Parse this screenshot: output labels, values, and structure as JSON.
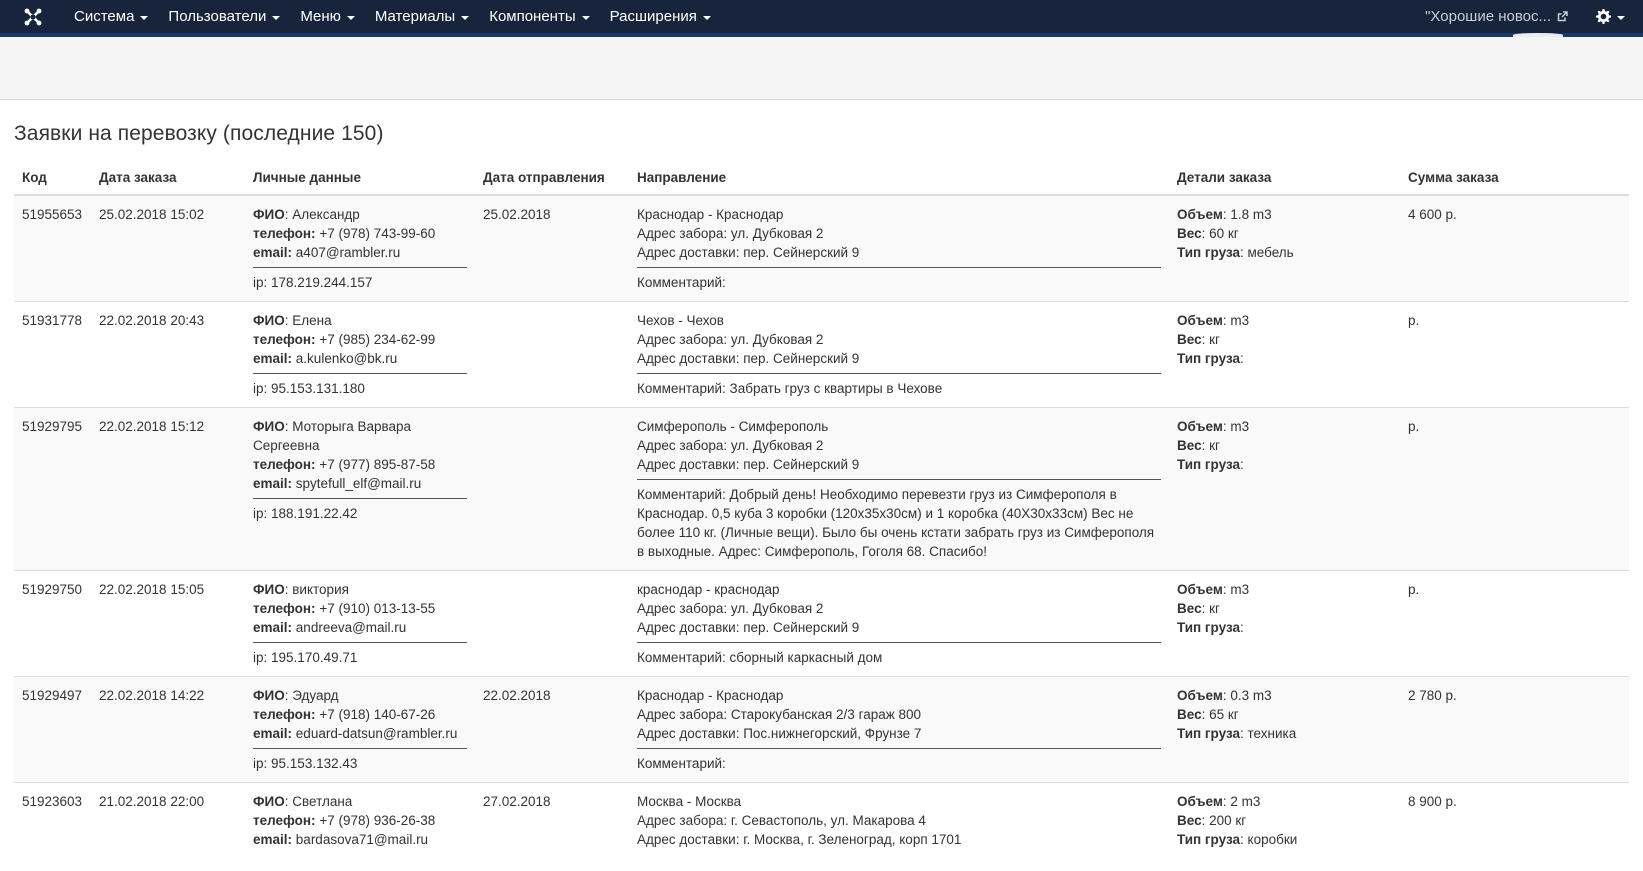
{
  "navbar": {
    "menu": [
      {
        "label": "Система"
      },
      {
        "label": "Пользователи"
      },
      {
        "label": "Меню"
      },
      {
        "label": "Материалы"
      },
      {
        "label": "Компоненты"
      },
      {
        "label": "Расширения"
      }
    ],
    "site_link": "\"Хорошие новос...",
    "colors": {
      "navbar_bg": "#17243c",
      "navbar_border": "#1a3867"
    }
  },
  "page": {
    "title": "Заявки на перевозку (последние 150)"
  },
  "labels": {
    "fio": "ФИО",
    "phone": "телефон:",
    "email": "email:",
    "ip": "ip:",
    "pickup": "Адрес забора:",
    "delivery": "Адрес доставки:",
    "comment": "Комментарий:",
    "volume": "Объем",
    "weight": "Вес",
    "cargo_type": "Тип груза"
  },
  "table": {
    "headers": {
      "code": "Код",
      "order_date": "Дата заказа",
      "personal": "Личные данные",
      "send_date": "Дата отправления",
      "direction": "Направление",
      "details": "Детали заказа",
      "sum": "Сумма заказа"
    },
    "rows": [
      {
        "code": "51955653",
        "order_date": "25.02.2018 15:02",
        "name": "Александр",
        "phone": "+7 (978) 743-99-60",
        "email": "a407@rambler.ru",
        "ip": "178.219.244.157",
        "send_date": "25.02.2018",
        "route": "Краснодар - Краснодар",
        "pickup": "ул. Дубковая 2",
        "delivery": "пер. Сейнерский 9",
        "comment": "",
        "volume": "1.8 m3",
        "weight": "60 кг",
        "cargo": "мебель",
        "sum": "4 600 р."
      },
      {
        "code": "51931778",
        "order_date": "22.02.2018 20:43",
        "name": "Елена",
        "phone": "+7 (985) 234-62-99",
        "email": "a.kulenko@bk.ru",
        "ip": "95.153.131.180",
        "send_date": "",
        "route": "Чехов - Чехов",
        "pickup": "ул. Дубковая 2",
        "delivery": "пер. Сейнерский 9",
        "comment": "Забрать груз с квартиры в Чехове",
        "volume": "m3",
        "weight": "кг",
        "cargo": "",
        "sum": "р."
      },
      {
        "code": "51929795",
        "order_date": "22.02.2018 15:12",
        "name": "Моторыга Варвара Сергеевна",
        "phone": "+7 (977) 895-87-58",
        "email": "spytefull_elf@mail.ru",
        "ip": "188.191.22.42",
        "send_date": "",
        "route": "Симферополь - Симферополь",
        "pickup": "ул. Дубковая 2",
        "delivery": "пер. Сейнерский 9",
        "comment": "Добрый день! Необходимо перевезти груз из Симферополя в Краснодар. 0,5 куба 3 коробки (120х35х30см) и 1 коробка (40Х30х33см) Вес не более 110 кг. (Личные вещи). Было бы очень кстати забрать груз из Симферополя в выходные. Адрес: Симферополь, Гоголя 68. Спасибо!",
        "volume": "m3",
        "weight": "кг",
        "cargo": "",
        "sum": "р."
      },
      {
        "code": "51929750",
        "order_date": "22.02.2018 15:05",
        "name": "виктория",
        "phone": "+7 (910) 013-13-55",
        "email": "andreeva@mail.ru",
        "ip": "195.170.49.71",
        "send_date": "",
        "route": "краснодар - краснодар",
        "pickup": "ул. Дубковая 2",
        "delivery": "пер. Сейнерский 9",
        "comment": "сборный каркасный дом",
        "volume": "m3",
        "weight": "кг",
        "cargo": "",
        "sum": "р."
      },
      {
        "code": "51929497",
        "order_date": "22.02.2018 14:22",
        "name": "Эдуард",
        "phone": "+7 (918) 140-67-26",
        "email": "eduard-datsun@rambler.ru",
        "ip": "95.153.132.43",
        "send_date": "22.02.2018",
        "route": "Краснодар - Краснодар",
        "pickup": "Старокубанская 2/3 гараж 800",
        "delivery": "Пос.нижнегорский, Фрунзе 7",
        "comment": "",
        "volume": "0.3 m3",
        "weight": "65 кг",
        "cargo": "техника",
        "sum": "2 780 р."
      },
      {
        "code": "51923603",
        "order_date": "21.02.2018 22:00",
        "name": "Светлана",
        "phone": "+7 (978) 936-26-38",
        "email": "bardasova71@mail.ru",
        "ip": "",
        "send_date": "27.02.2018",
        "route": "Москва - Москва",
        "pickup": "г. Севастополь, ул. Макарова 4",
        "delivery": "г. Москва, г. Зеленоград, корп 1701",
        "comment": "",
        "volume": "2 m3",
        "weight": "200 кг",
        "cargo": "коробки",
        "sum": "8 900 р."
      }
    ]
  }
}
